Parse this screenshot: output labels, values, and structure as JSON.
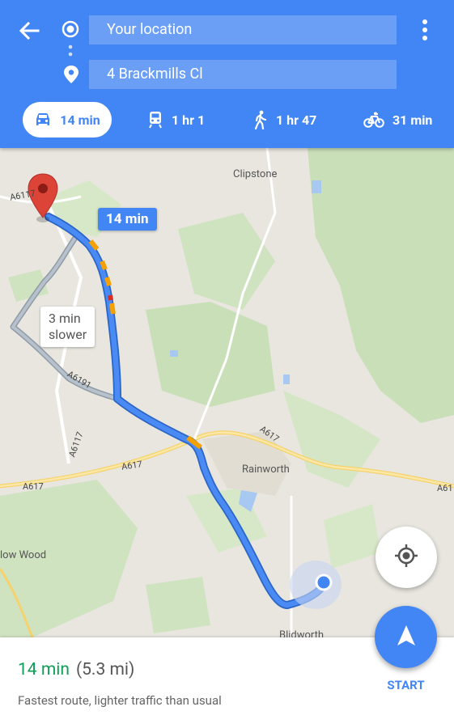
{
  "header": {
    "origin_text": "Your location",
    "destination_text": "4 Brackmills Cl",
    "modes": [
      {
        "icon": "car-icon",
        "label": "14 min"
      },
      {
        "icon": "train-icon",
        "label": "1 hr 1"
      },
      {
        "icon": "walk-icon",
        "label": "1 hr 47"
      },
      {
        "icon": "bike-icon",
        "label": "31 min"
      }
    ]
  },
  "map": {
    "places": {
      "clipstone": "Clipstone",
      "rainworth": "Rainworth",
      "blidworth_partial": "Blidworth",
      "low_wood_partial": "low Wood"
    },
    "roads": {
      "a6117_top": "A6117",
      "a6191": "A6191",
      "a6117_mid": "A6117",
      "a617_mid": "A617",
      "a617_left": "A617",
      "a617_right": "A617",
      "a61_edge": "A61"
    },
    "route_time_label": "14 min",
    "alt_route_label_line1": "3 min",
    "alt_route_label_line2": "slower"
  },
  "summary": {
    "time": "14 min",
    "distance": "(5.3 mi)",
    "description": "Fastest route, lighter traffic than usual",
    "start_label": "START"
  },
  "colors": {
    "brand_blue": "#4285f4",
    "eta_green": "#0f9d58",
    "pin_red": "#db4437",
    "traffic_orange": "#f4a100"
  }
}
